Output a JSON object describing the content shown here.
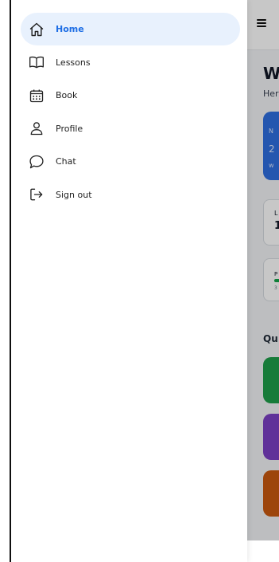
{
  "drawer": {
    "items": [
      {
        "label": "Home",
        "icon": "home-icon",
        "active": true
      },
      {
        "label": "Lessons",
        "icon": "book-open-icon",
        "active": false
      },
      {
        "label": "Book",
        "icon": "calendar-icon",
        "active": false
      },
      {
        "label": "Profile",
        "icon": "user-icon",
        "active": false
      },
      {
        "label": "Chat",
        "icon": "chat-bubble-icon",
        "active": false
      },
      {
        "label": "Sign out",
        "icon": "sign-out-icon",
        "active": false
      }
    ]
  },
  "main": {
    "menu_icon": "hamburger-icon",
    "welcome_partial": "W",
    "subtitle_partial": "Her",
    "next_card": {
      "line1": "N",
      "line2": "2",
      "line3": "w"
    },
    "lessons_card": {
      "label": "L",
      "value": "1"
    },
    "progress_card": {
      "label": "P",
      "caption": "3",
      "progress_percent": 25
    },
    "quick_title_partial": "Qu",
    "quick_tiles": [
      {
        "color": "#1e9e4a"
      },
      {
        "color": "#7b3fc4"
      },
      {
        "color": "#c9590f"
      }
    ]
  },
  "colors": {
    "accent": "#1f6fe5",
    "active_bg": "#e8f1fd",
    "next_card_bg": "#2f6fe0"
  }
}
